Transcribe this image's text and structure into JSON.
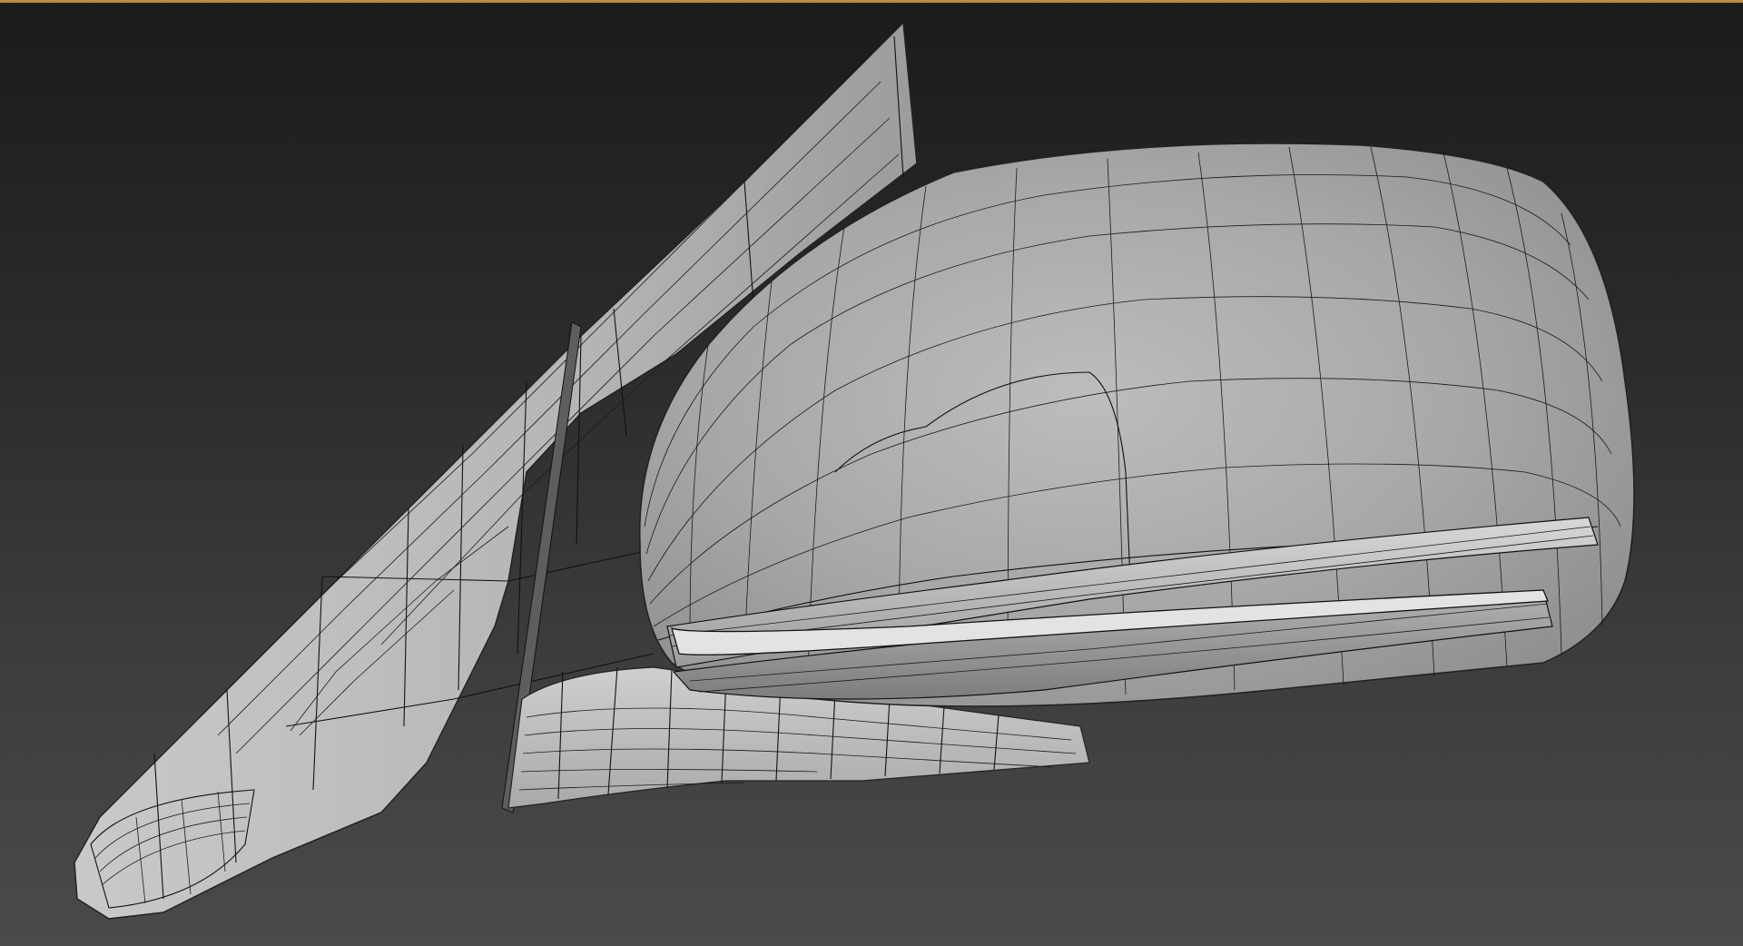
{
  "viewport": {
    "active_border_color": "#b8912f",
    "background_top": "#1b1b1b",
    "background_bottom": "#4a4a4a",
    "object": "car-side-mirror-mesh",
    "display_mode": "shaded-with-wireframe-edges"
  }
}
